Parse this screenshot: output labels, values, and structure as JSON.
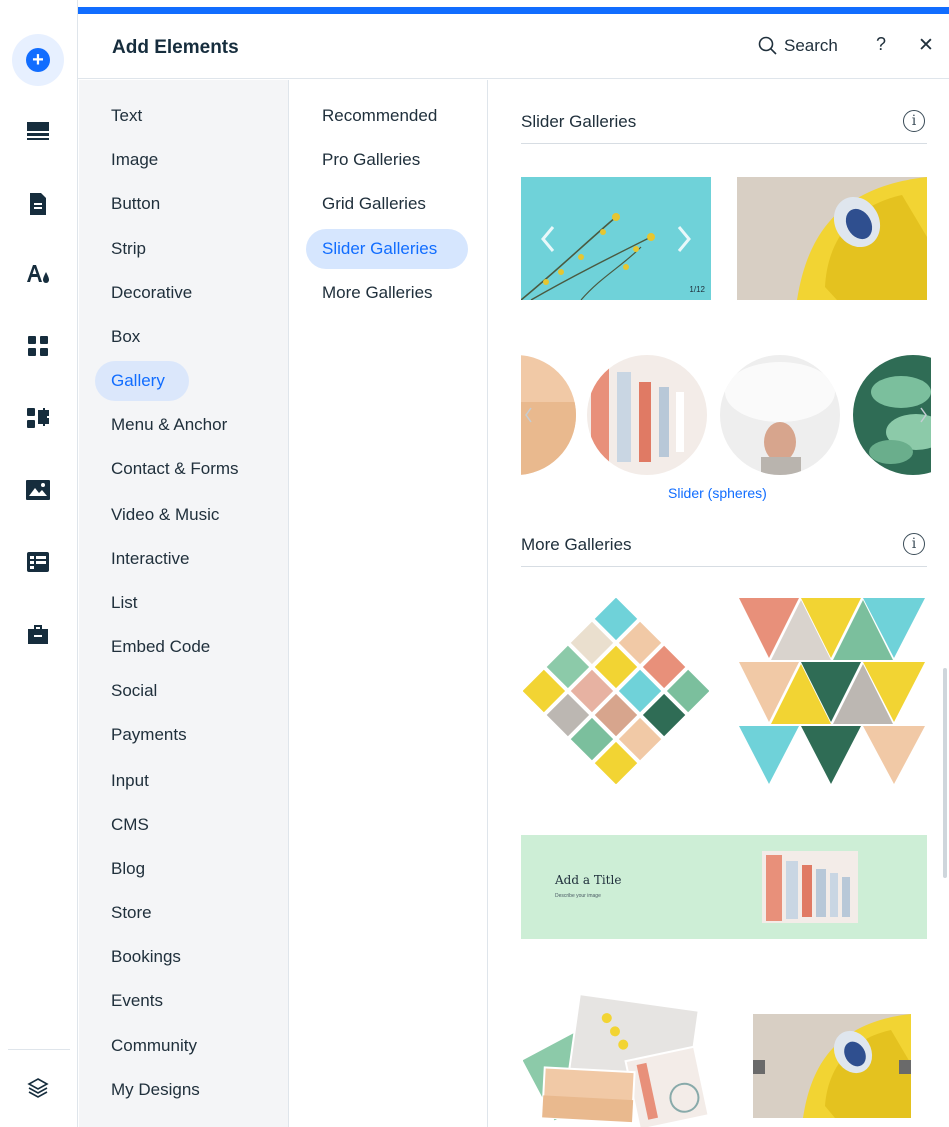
{
  "header": {
    "title": "Add Elements",
    "search_label": "Search",
    "help_label": "?",
    "close_label": "✕"
  },
  "rail": {
    "items": [
      {
        "icon": "add-icon"
      },
      {
        "icon": "sections-icon"
      },
      {
        "icon": "pages-icon"
      },
      {
        "icon": "theme-icon"
      },
      {
        "icon": "apps-icon"
      },
      {
        "icon": "business-apps-icon"
      },
      {
        "icon": "media-icon"
      },
      {
        "icon": "cms-icon"
      },
      {
        "icon": "portfolio-icon"
      },
      {
        "icon": "layers-icon"
      }
    ]
  },
  "categories": {
    "active": "Gallery",
    "items": [
      "Text",
      "Image",
      "Button",
      "Strip",
      "Decorative",
      "Box",
      "Gallery",
      "Menu & Anchor",
      "Contact & Forms",
      "Video & Music",
      "Interactive",
      "List",
      "Embed Code",
      "Social",
      "Payments",
      "Input",
      "CMS",
      "Blog",
      "Store",
      "Bookings",
      "Events",
      "Community",
      "My Designs"
    ]
  },
  "subcategories": {
    "active": "Slider Galleries",
    "items": [
      "Recommended",
      "Pro Galleries",
      "Grid Galleries",
      "Slider Galleries",
      "More Galleries"
    ]
  },
  "content": {
    "slider_section_title": "Slider Galleries",
    "more_section_title": "More Galleries",
    "info_label": "i",
    "slider_counter": "1/12",
    "spheres_caption": "Slider (spheres)",
    "banner_title": "Add a Title",
    "banner_subtitle": "Describe your image"
  },
  "colors": {
    "accent": "#116dff",
    "active_pill": "#d6e6fe",
    "sidebar_bg": "#f4f5f7",
    "banner_bg": "#cdeed6",
    "yellow": "#f2d433",
    "teal": "#6fd2d9"
  }
}
